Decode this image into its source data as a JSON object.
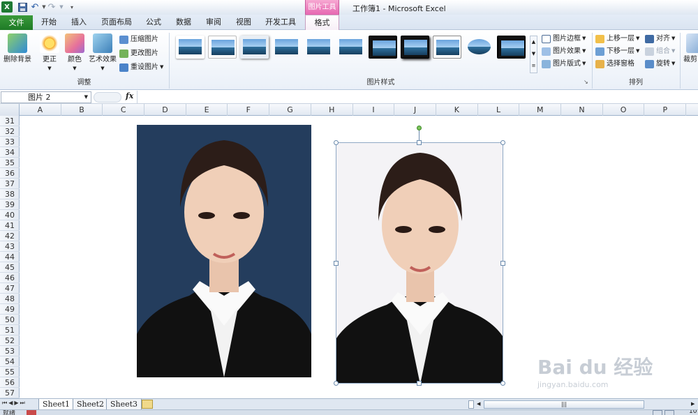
{
  "window": {
    "title": "工作簿1 - Microsoft Excel",
    "context_tab_group": "图片工具"
  },
  "tabs": [
    {
      "label": "文件"
    },
    {
      "label": "开始"
    },
    {
      "label": "插入"
    },
    {
      "label": "页面布局"
    },
    {
      "label": "公式"
    },
    {
      "label": "数据"
    },
    {
      "label": "审阅"
    },
    {
      "label": "视图"
    },
    {
      "label": "开发工具"
    },
    {
      "label": "格式"
    }
  ],
  "ribbon": {
    "adjust": {
      "group_label": "调整",
      "remove_bg": "删除背景",
      "corrections": "更正",
      "color": "颜色",
      "artistic": "艺术效果",
      "compress": "压缩图片",
      "change": "更改图片",
      "reset": "重设图片"
    },
    "styles": {
      "group_label": "图片样式",
      "border": "图片边框",
      "effects": "图片效果",
      "layout": "图片版式"
    },
    "arrange": {
      "group_label": "排列",
      "bring_forward": "上移一层",
      "send_backward": "下移一层",
      "selection_pane": "选择窗格",
      "align": "对齐",
      "group": "组合",
      "rotate": "旋转"
    },
    "size": {
      "crop": "裁剪"
    }
  },
  "formula_bar": {
    "name_box": "图片 2",
    "fx": "fx",
    "value": ""
  },
  "columns": [
    "A",
    "B",
    "C",
    "D",
    "E",
    "F",
    "G",
    "H",
    "I",
    "J",
    "K",
    "L",
    "M",
    "N",
    "O",
    "P"
  ],
  "rows": [
    "31",
    "32",
    "33",
    "34",
    "35",
    "36",
    "37",
    "38",
    "39",
    "40",
    "41",
    "42",
    "43",
    "44",
    "45",
    "46",
    "47",
    "48",
    "49",
    "50",
    "51",
    "52",
    "53",
    "54",
    "55",
    "56",
    "57"
  ],
  "sheets": [
    "Sheet1",
    "Sheet2",
    "Sheet3"
  ],
  "status": {
    "ready": "就绪",
    "zoom": "10"
  },
  "watermark": {
    "brand": "Bai du 经验",
    "url": "jingyan.baidu.com"
  },
  "colors": {
    "file_tab": "#2a8a32",
    "context_tab": "#e06aae",
    "photo_left_bg": "#243d5d",
    "photo_right_bg": "#f4f3f6"
  }
}
